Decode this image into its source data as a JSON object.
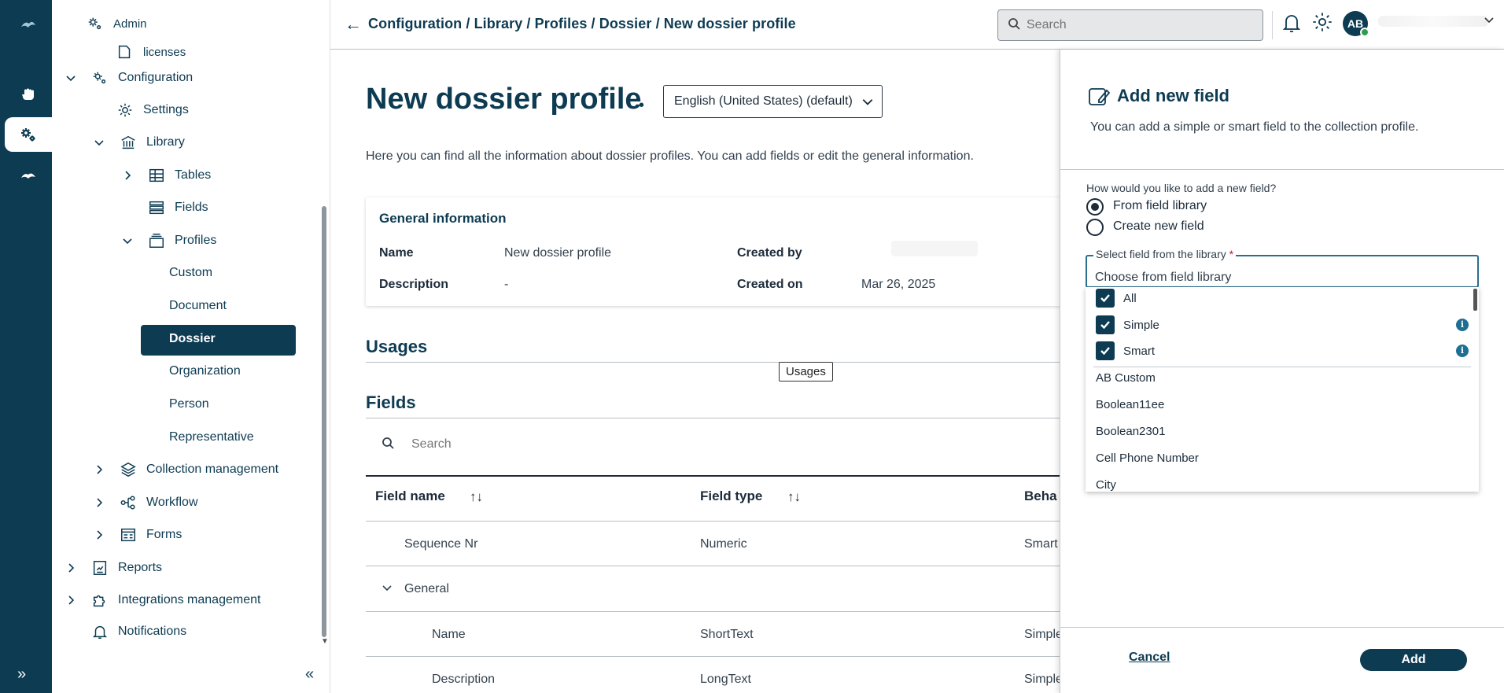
{
  "breadcrumb": {
    "text": "Configuration / Library / Profiles / Dossier / New dossier profile"
  },
  "topbar": {
    "search_placeholder": "Search",
    "avatar_initials": "AB"
  },
  "nav": {
    "items": [
      {
        "label": "Admin"
      },
      {
        "label": "licenses"
      },
      {
        "label": "Configuration"
      },
      {
        "label": "Settings"
      },
      {
        "label": "Library"
      },
      {
        "label": "Tables"
      },
      {
        "label": "Fields"
      },
      {
        "label": "Profiles"
      },
      {
        "label": "Custom"
      },
      {
        "label": "Document"
      },
      {
        "label": "Dossier"
      },
      {
        "label": "Organization"
      },
      {
        "label": "Person"
      },
      {
        "label": "Representative"
      },
      {
        "label": "Collection management"
      },
      {
        "label": "Workflow"
      },
      {
        "label": "Forms"
      },
      {
        "label": "Reports"
      },
      {
        "label": "Integrations management"
      },
      {
        "label": "Notifications"
      }
    ]
  },
  "main": {
    "title": "New dossier profile",
    "language": "English (United States) (default)",
    "intro": "Here you can find all the information about dossier profiles. You can add fields or edit the general information.",
    "general": {
      "title": "General information",
      "name_label": "Name",
      "name_value": "New dossier profile",
      "description_label": "Description",
      "description_value": "-",
      "created_by_label": "Created by",
      "created_on_label": "Created on",
      "created_on_value": "Mar 26, 2025"
    },
    "usages_heading": "Usages",
    "usages_tooltip": "Usages",
    "fields_heading": "Fields",
    "fields_search_placeholder": "Search",
    "columns": [
      "Field name",
      "Field type",
      "Beha"
    ],
    "rows": [
      {
        "name": "Sequence Nr",
        "type": "Numeric",
        "behavior": "Smart"
      },
      {
        "name": "General",
        "type": "",
        "behavior": ""
      },
      {
        "name": "Name",
        "type": "ShortText",
        "behavior": "Simple"
      },
      {
        "name": "Description",
        "type": "LongText",
        "behavior": "Simple"
      }
    ]
  },
  "panel": {
    "title": "Add new field",
    "subtitle": "You can add a simple or smart field to the collection profile.",
    "question": "How would you like to add a new field?",
    "option_library": "From field library",
    "option_create": "Create new field",
    "selected_option": "From field library",
    "select_label": "Select field from the library",
    "required_mark": "*",
    "select_value": "Choose from field library",
    "filters": [
      {
        "label": "All",
        "checked": true
      },
      {
        "label": "Simple",
        "checked": true
      },
      {
        "label": "Smart",
        "checked": true
      }
    ],
    "options": [
      "AB Custom",
      "Boolean11ee",
      "Boolean2301",
      "Cell Phone Number",
      "City"
    ],
    "cancel_label": "Cancel",
    "add_label": "Add"
  },
  "colors": {
    "brand": "#0d3b52",
    "info": "#1f6f93",
    "required": "#c8102e",
    "online": "#2e9e4c"
  }
}
